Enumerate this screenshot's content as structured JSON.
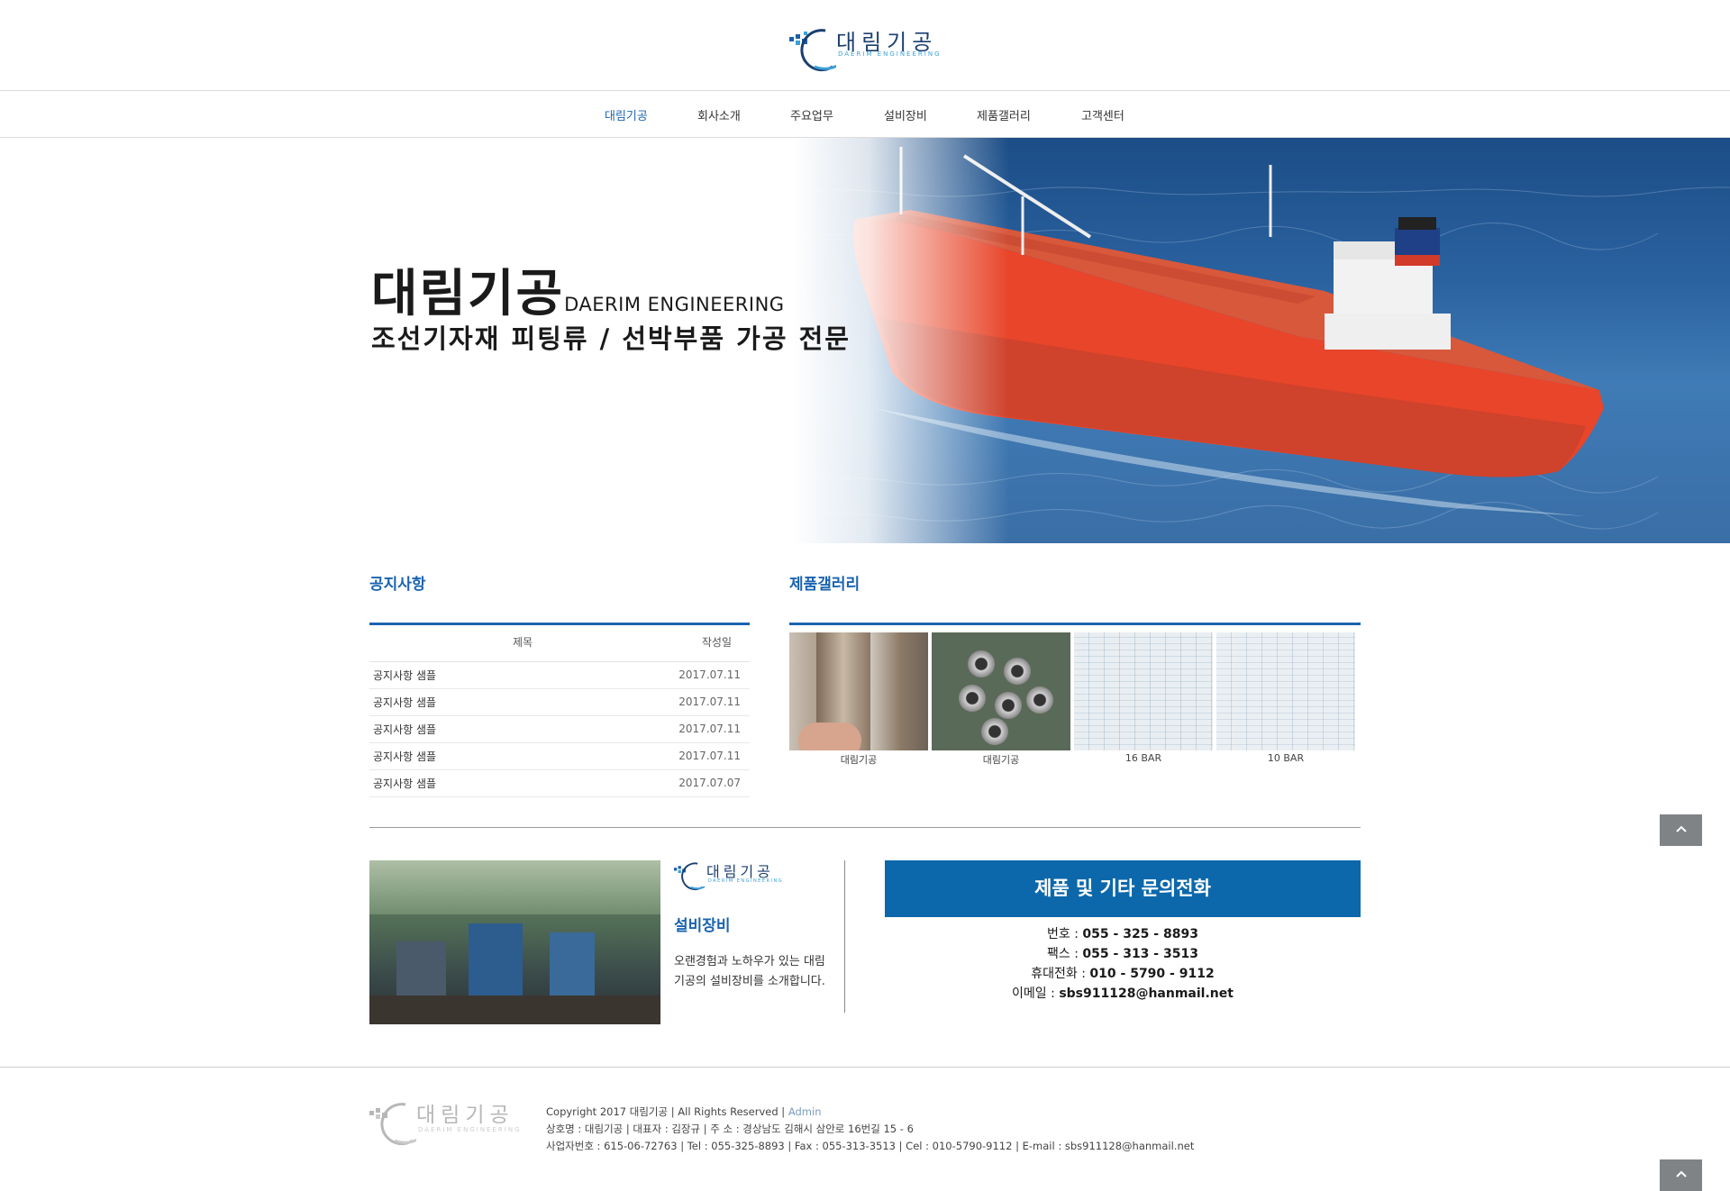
{
  "header": {
    "logo_text": "대림기공",
    "logo_sub": "DAERIM ENGINEERING"
  },
  "nav": {
    "items": [
      {
        "label": "대림기공",
        "active": true
      },
      {
        "label": "회사소개"
      },
      {
        "label": "주요업무"
      },
      {
        "label": "설비장비"
      },
      {
        "label": "제품갤러리"
      },
      {
        "label": "고객센터"
      }
    ]
  },
  "hero": {
    "title_ko": "대림기공",
    "title_en": "DAERIM ENGINEERING",
    "subtitle": "조선기자재 피팅류 / 선박부품 가공 전문"
  },
  "notice": {
    "title": "공지사항",
    "col_title": "제목",
    "col_date": "작성일",
    "rows": [
      {
        "title": "공지사항 샘플",
        "date": "2017.07.11"
      },
      {
        "title": "공지사항 샘플",
        "date": "2017.07.11"
      },
      {
        "title": "공지사항 샘플",
        "date": "2017.07.11"
      },
      {
        "title": "공지사항 샘플",
        "date": "2017.07.11"
      },
      {
        "title": "공지사항 샘플",
        "date": "2017.07.07"
      }
    ]
  },
  "gallery": {
    "title": "제품갤러리",
    "items": [
      {
        "caption": "대림기공"
      },
      {
        "caption": "대림기공"
      },
      {
        "caption": "16 BAR"
      },
      {
        "caption": "10 BAR"
      }
    ]
  },
  "facility": {
    "logo_text": "대림기공",
    "logo_sub": "DAERIM ENGINEERING",
    "title": "설비장비",
    "desc": "오랜경험과 노하우가 있는 대림기공의 설비장비를 소개합니다."
  },
  "contact": {
    "heading": "제품 및 기타 문의전화",
    "lines": [
      {
        "label": "번호 : ",
        "value": "055 - 325 - 8893"
      },
      {
        "label": "팩스 : ",
        "value": "055 - 313 - 3513"
      },
      {
        "label": "휴대전화 : ",
        "value": "010 - 5790 - 9112"
      },
      {
        "label": "이메일 : ",
        "value": "sbs911128@hanmail.net"
      }
    ]
  },
  "footer": {
    "logo_text": "대림기공",
    "logo_sub": "DAERIM ENGINEERING",
    "copyright": "Copyright 2017 대림기공 | All Rights Reserved | ",
    "admin": "Admin",
    "line2": "상호명 : 대림기공 | 대표자 : 김장규 | 주 소 : 경상남도 김해시 삼안로 16번길 15 - 6",
    "line3": "사업자번호 : 615-06-72763 | Tel : 055-325-8893 | Fax : 055-313-3513 | Cel : 010-5790-9112 | E-mail : sbs911128@hanmail.net"
  },
  "colors": {
    "accent": "#1b64b0",
    "contact_bg": "#0c68ab",
    "ship_red": "#e8452a"
  },
  "icons": {
    "totop": "chevron-up-icon"
  }
}
